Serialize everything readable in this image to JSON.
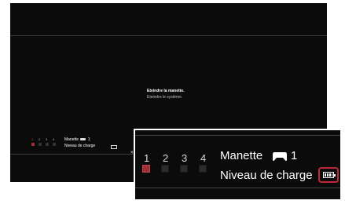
{
  "menu": {
    "selected": "Eteindre la manette.",
    "second": "Eteindre le système."
  },
  "status": {
    "ports": [
      "1",
      "2",
      "3",
      "4"
    ],
    "active_port": "1",
    "controller_label": "Manette",
    "controller_number": "1",
    "charge_label": "Niveau de charge",
    "battery_level": 1.0
  },
  "close_symbol": "×",
  "icons": {
    "controller": "gamepad-icon",
    "battery": "battery-full-icon"
  },
  "colors": {
    "background": "#0b0b0b",
    "active_port": "#a13036",
    "highlight_border": "#c0283a"
  }
}
